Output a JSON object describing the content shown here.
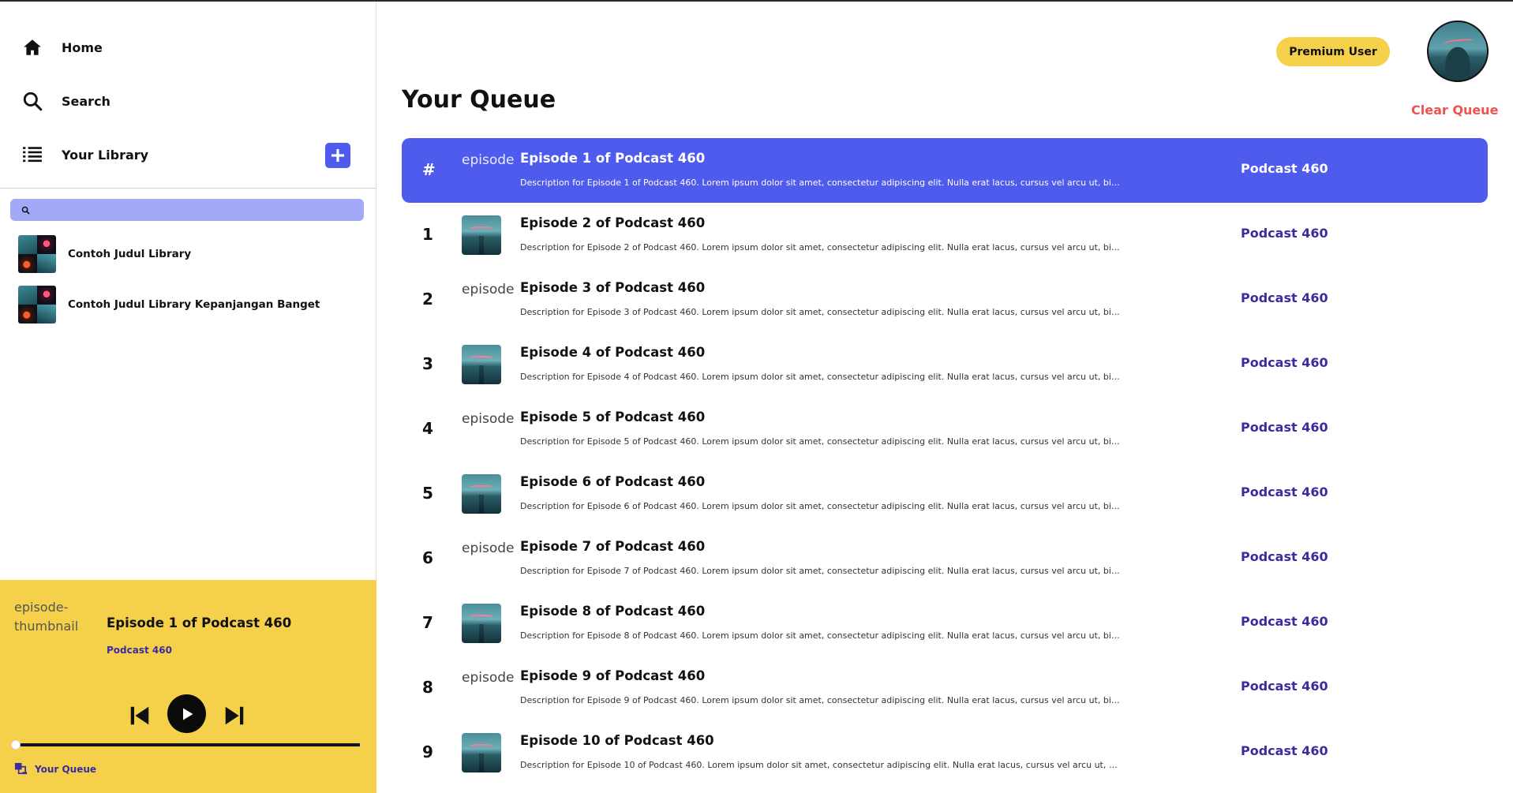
{
  "nav": {
    "home": "Home",
    "search": "Search",
    "library": "Your Library"
  },
  "library": {
    "search_placeholder": "",
    "items": [
      {
        "title": "Contoh Judul Library"
      },
      {
        "title": "Contoh Judul Library Kepanjangan Banget"
      }
    ]
  },
  "player": {
    "thumbnail_alt": "episode-thumbnail",
    "title": "Episode 1 of Podcast 460",
    "podcast": "Podcast 460",
    "progress": 0,
    "queue_link": "Your Queue"
  },
  "header": {
    "premium_label": "Premium User"
  },
  "main": {
    "title": "Your Queue",
    "clear_label": "Clear Queue",
    "current_marker": "#",
    "thumbnail_alt": "episode",
    "rows": [
      {
        "num": "#",
        "title": "Episode 1 of Podcast 460",
        "desc": "Description for Episode 1 of Podcast 460. Lorem ipsum dolor sit amet, consectetur adipiscing elit. Nulla erat lacus, cursus vel arcu ut, bibendum",
        "podcast": "Podcast 460",
        "current": true,
        "thumb": "alt"
      },
      {
        "num": "1",
        "title": "Episode 2 of Podcast 460",
        "desc": "Description for Episode 2 of Podcast 460. Lorem ipsum dolor sit amet, consectetur adipiscing elit. Nulla erat lacus, cursus vel arcu ut, bibendum",
        "podcast": "Podcast 460",
        "current": false,
        "thumb": "img"
      },
      {
        "num": "2",
        "title": "Episode 3 of Podcast 460",
        "desc": "Description for Episode 3 of Podcast 460. Lorem ipsum dolor sit amet, consectetur adipiscing elit. Nulla erat lacus, cursus vel arcu ut, bibendum",
        "podcast": "Podcast 460",
        "current": false,
        "thumb": "alt"
      },
      {
        "num": "3",
        "title": "Episode 4 of Podcast 460",
        "desc": "Description for Episode 4 of Podcast 460. Lorem ipsum dolor sit amet, consectetur adipiscing elit. Nulla erat lacus, cursus vel arcu ut, bibendum",
        "podcast": "Podcast 460",
        "current": false,
        "thumb": "img"
      },
      {
        "num": "4",
        "title": "Episode 5 of Podcast 460",
        "desc": "Description for Episode 5 of Podcast 460. Lorem ipsum dolor sit amet, consectetur adipiscing elit. Nulla erat lacus, cursus vel arcu ut, bibendum",
        "podcast": "Podcast 460",
        "current": false,
        "thumb": "alt"
      },
      {
        "num": "5",
        "title": "Episode 6 of Podcast 460",
        "desc": "Description for Episode 6 of Podcast 460. Lorem ipsum dolor sit amet, consectetur adipiscing elit. Nulla erat lacus, cursus vel arcu ut, bibendum",
        "podcast": "Podcast 460",
        "current": false,
        "thumb": "img"
      },
      {
        "num": "6",
        "title": "Episode 7 of Podcast 460",
        "desc": "Description for Episode 7 of Podcast 460. Lorem ipsum dolor sit amet, consectetur adipiscing elit. Nulla erat lacus, cursus vel arcu ut, bibendum",
        "podcast": "Podcast 460",
        "current": false,
        "thumb": "alt"
      },
      {
        "num": "7",
        "title": "Episode 8 of Podcast 460",
        "desc": "Description for Episode 8 of Podcast 460. Lorem ipsum dolor sit amet, consectetur adipiscing elit. Nulla erat lacus, cursus vel arcu ut, bibendum",
        "podcast": "Podcast 460",
        "current": false,
        "thumb": "img"
      },
      {
        "num": "8",
        "title": "Episode 9 of Podcast 460",
        "desc": "Description for Episode 9 of Podcast 460. Lorem ipsum dolor sit amet, consectetur adipiscing elit. Nulla erat lacus, cursus vel arcu ut, bibendum",
        "podcast": "Podcast 460",
        "current": false,
        "thumb": "alt"
      },
      {
        "num": "9",
        "title": "Episode 10 of Podcast 460",
        "desc": "Description for Episode 10 of Podcast 460. Lorem ipsum dolor sit amet, consectetur adipiscing elit. Nulla erat lacus, cursus vel arcu ut, bibendum",
        "podcast": "Podcast 460",
        "current": false,
        "thumb": "img"
      }
    ]
  },
  "colors": {
    "accent": "#4f5bed",
    "player_bg": "#f5d04a",
    "link": "#3a2ba0",
    "danger": "#ef5350"
  },
  "icons": [
    "home-icon",
    "search-icon",
    "list-icon",
    "plus-icon",
    "previous-icon",
    "play-icon",
    "next-icon",
    "queue-icon"
  ]
}
